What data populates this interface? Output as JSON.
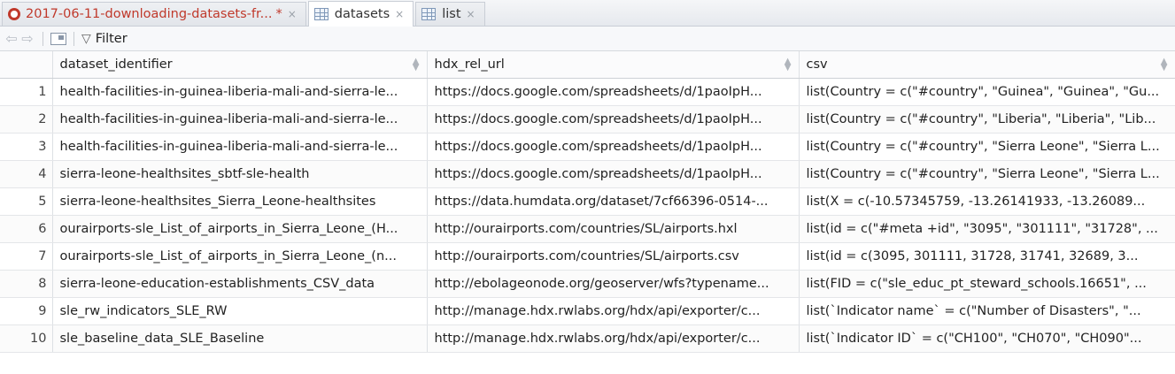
{
  "tabs": [
    {
      "label": "2017-06-11-downloading-datasets-fr...",
      "modified": "*",
      "icon": "r-file-icon",
      "close": "×"
    },
    {
      "label": "datasets",
      "icon": "grid-icon",
      "close": "×"
    },
    {
      "label": "list",
      "icon": "grid-icon",
      "close": "×"
    }
  ],
  "toolbar": {
    "filter_label": "Filter"
  },
  "table": {
    "columns": [
      "dataset_identifier",
      "hdx_rel_url",
      "csv"
    ],
    "rows": [
      {
        "n": "1",
        "dataset_identifier": "health-facilities-in-guinea-liberia-mali-and-sierra-le...",
        "hdx_rel_url": "https://docs.google.com/spreadsheets/d/1paoIpH...",
        "csv": "list(Country = c(\"#country\", \"Guinea\", \"Guinea\", \"Gu..."
      },
      {
        "n": "2",
        "dataset_identifier": "health-facilities-in-guinea-liberia-mali-and-sierra-le...",
        "hdx_rel_url": "https://docs.google.com/spreadsheets/d/1paoIpH...",
        "csv": "list(Country = c(\"#country\", \"Liberia\", \"Liberia\", \"Lib..."
      },
      {
        "n": "3",
        "dataset_identifier": "health-facilities-in-guinea-liberia-mali-and-sierra-le...",
        "hdx_rel_url": "https://docs.google.com/spreadsheets/d/1paoIpH...",
        "csv": "list(Country = c(\"#country\", \"Sierra Leone\", \"Sierra L..."
      },
      {
        "n": "4",
        "dataset_identifier": "sierra-leone-healthsites_sbtf-sle-health",
        "hdx_rel_url": "https://docs.google.com/spreadsheets/d/1paoIpH...",
        "csv": "list(Country = c(\"#country\", \"Sierra Leone\", \"Sierra L..."
      },
      {
        "n": "5",
        "dataset_identifier": "sierra-leone-healthsites_Sierra_Leone-healthsites",
        "hdx_rel_url": "https://data.humdata.org/dataset/7cf66396-0514-...",
        "csv": "list(X = c(-10.57345759, -13.26141933, -13.26089..."
      },
      {
        "n": "6",
        "dataset_identifier": "ourairports-sle_List_of_airports_in_Sierra_Leone_(H...",
        "hdx_rel_url": "http://ourairports.com/countries/SL/airports.hxl",
        "csv": "list(id = c(\"#meta +id\", \"3095\", \"301111\", \"31728\", ..."
      },
      {
        "n": "7",
        "dataset_identifier": "ourairports-sle_List_of_airports_in_Sierra_Leone_(n...",
        "hdx_rel_url": "http://ourairports.com/countries/SL/airports.csv",
        "csv": "list(id = c(3095, 301111, 31728, 31741, 32689, 3..."
      },
      {
        "n": "8",
        "dataset_identifier": "sierra-leone-education-establishments_CSV_data",
        "hdx_rel_url": "http://ebolageonode.org/geoserver/wfs?typename...",
        "csv": "list(FID = c(\"sle_educ_pt_steward_schools.16651\", ..."
      },
      {
        "n": "9",
        "dataset_identifier": "sle_rw_indicators_SLE_RW",
        "hdx_rel_url": "http://manage.hdx.rwlabs.org/hdx/api/exporter/c...",
        "csv": "list(`Indicator name` = c(\"Number of Disasters\", \"..."
      },
      {
        "n": "10",
        "dataset_identifier": "sle_baseline_data_SLE_Baseline",
        "hdx_rel_url": "http://manage.hdx.rwlabs.org/hdx/api/exporter/c...",
        "csv": "list(`Indicator ID` = c(\"CH100\", \"CH070\", \"CH090\"..."
      }
    ]
  }
}
